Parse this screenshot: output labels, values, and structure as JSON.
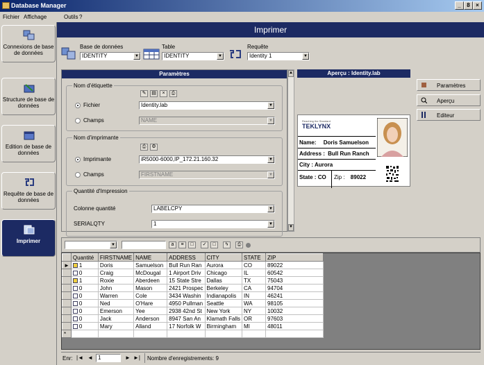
{
  "window": {
    "title": "Database Manager",
    "buttons": [
      "_",
      "8",
      "×"
    ]
  },
  "menu": [
    "Fichier",
    "Affichage",
    "Outils",
    "?"
  ],
  "sidebar": {
    "items": [
      {
        "label": "Connexions de base de données",
        "icon": "database-connection-icon",
        "active": false
      },
      {
        "label": "Structure de base de données",
        "icon": "structure-icon",
        "active": false
      },
      {
        "label": "Edition de base de données",
        "icon": "edit-database-icon",
        "active": false
      },
      {
        "label": "Requête de base de données",
        "icon": "query-icon",
        "active": false
      },
      {
        "label": "Imprimer",
        "icon": "print-icon",
        "active": true
      }
    ]
  },
  "header": {
    "title": "Imprimer"
  },
  "source": {
    "db_label": "Base de données",
    "db_value": "IDENTITY",
    "table_label": "Table",
    "table_value": "IDENTITY",
    "query_label": "Requête",
    "query_value": "Identity 1"
  },
  "params": {
    "title": "Paramètres",
    "label_group": {
      "title": "Nom d'étiquette",
      "file_label": "Fichier",
      "file_value": "Identity.lab",
      "field_label": "Champs",
      "field_value": "NAME"
    },
    "printer_group": {
      "title": "Nom d'imprimante",
      "printer_label": "Imprimante",
      "printer_value": "iR5000-6000,IP_172.21.160.32",
      "field_label": "Champs",
      "field_value": "FIRSTNAME"
    },
    "qty_group": {
      "title": "Quantité d'Impression",
      "col_label": "Colonne quantité",
      "col_value": "LABELCPY",
      "serial_label": "SERIALQTY",
      "serial_value": "1"
    }
  },
  "preview": {
    "title": "Aperçu : Identity.lab",
    "brand": "TEKLYNX",
    "tagline": "Reaching the Standard",
    "name_label": "Name:",
    "name_value": "Doris Samuelson",
    "address_label": "Address :",
    "address_value": "Bull Run Ranch",
    "city_label": "City :",
    "city_value": "Aurora",
    "state_label": "State :",
    "state_value": "CO",
    "zip_label": "Zip :",
    "zip_value": "89022"
  },
  "right_buttons": [
    {
      "label": "Paramètres",
      "icon": "settings-icon"
    },
    {
      "label": "Aperçu",
      "icon": "preview-icon"
    },
    {
      "label": "Editeur",
      "icon": "editor-icon"
    }
  ],
  "grid": {
    "columns": [
      "Quantité",
      "FIRSTNAME",
      "NAME",
      "ADDRESS",
      "CITY",
      "STATE",
      "ZIP"
    ],
    "rows": [
      {
        "qty": "1",
        "checked": true,
        "first": "Doris",
        "name": "Samuelson",
        "address": "Bull Run Ran",
        "city": "Aurora",
        "state": "CO",
        "zip": "89022"
      },
      {
        "qty": "0",
        "checked": false,
        "first": "Craig",
        "name": "McDougal",
        "address": "1 Airport Driv",
        "city": "Chicago",
        "state": "IL",
        "zip": "60542"
      },
      {
        "qty": "1",
        "checked": true,
        "first": "Roxie",
        "name": "Aberdeen",
        "address": "15 State Stre",
        "city": "Dallas",
        "state": "TX",
        "zip": "75043"
      },
      {
        "qty": "0",
        "checked": false,
        "first": "John",
        "name": "Mason",
        "address": "2421 Prospec",
        "city": "Berkeley",
        "state": "CA",
        "zip": "94704"
      },
      {
        "qty": "0",
        "checked": false,
        "first": "Warren",
        "name": "Cole",
        "address": "3434 Washin",
        "city": "Indianapolis",
        "state": "IN",
        "zip": "46241"
      },
      {
        "qty": "0",
        "checked": false,
        "first": "Ned",
        "name": "O'Hare",
        "address": "4950 Pullman",
        "city": "Seattle",
        "state": "WA",
        "zip": "98105"
      },
      {
        "qty": "0",
        "checked": false,
        "first": "Emerson",
        "name": "Yee",
        "address": "2938 42nd St",
        "city": "New York",
        "state": "NY",
        "zip": "10032"
      },
      {
        "qty": "0",
        "checked": false,
        "first": "Jack",
        "name": "Anderson",
        "address": "8947 San An",
        "city": "Klamath Falls",
        "state": "OR",
        "zip": "97603"
      },
      {
        "qty": "0",
        "checked": false,
        "first": "Mary",
        "name": "Alland",
        "address": "17 Norfolk W",
        "city": "Birmingham",
        "state": "MI",
        "zip": "48011"
      }
    ]
  },
  "status": {
    "label": "Enr:",
    "page": "1",
    "count": "Nombre d'enregistrements: 9"
  }
}
